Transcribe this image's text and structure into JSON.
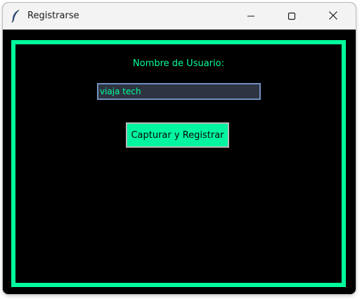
{
  "window": {
    "title": "Registrarse",
    "icons": {
      "app": "feather-icon",
      "minimize": "minimize-icon",
      "maximize": "maximize-icon",
      "close": "close-icon"
    }
  },
  "form": {
    "username_label": "Nombre de Usuario:",
    "username_value": "viaja tech",
    "submit_label": "Capturar y Registrar"
  },
  "colors": {
    "accent": "#00ff9c",
    "button_bg": "#00f5a0",
    "input_bg": "#2e3442",
    "input_border": "#6f8fbf",
    "background": "#000000",
    "titlebar": "#f3f3f3"
  }
}
